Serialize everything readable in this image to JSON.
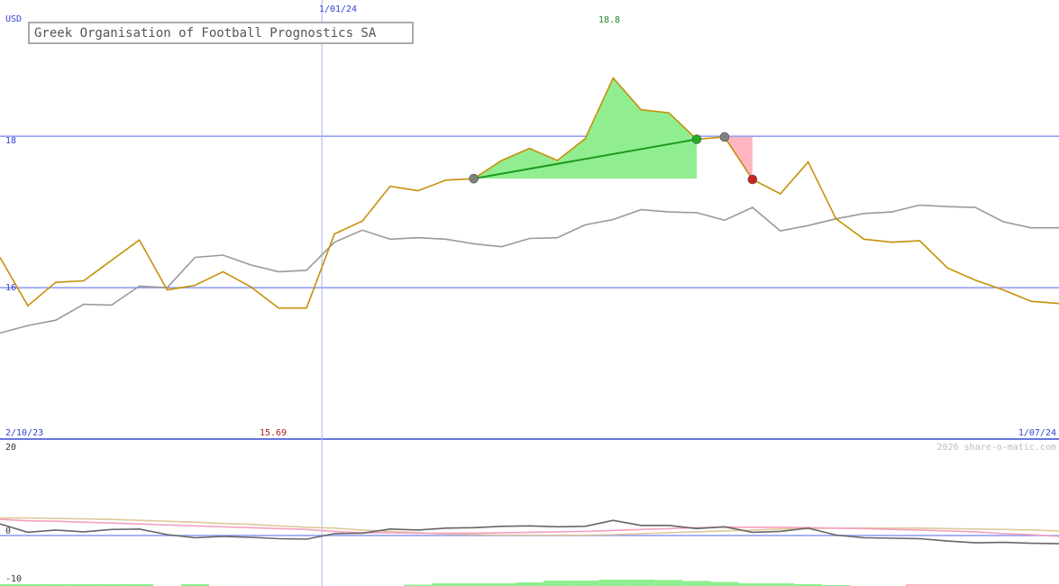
{
  "chart_data": [
    {
      "type": "line",
      "title": "Greek Organisation of Football Prognostics SA",
      "currency": "USD",
      "date_start": "2/10/23",
      "date_marker": "1/01/24",
      "date_end": "1/07/24",
      "y_ticks": [
        "18",
        "16"
      ],
      "ylim": [
        14.0,
        19.8
      ],
      "max_label": "18.8",
      "min_label": "15.69",
      "series": [
        {
          "values": [
            16.4,
            15.76,
            16.07,
            16.09,
            16.36,
            16.63,
            15.97,
            16.03,
            16.21,
            16.01,
            15.73,
            15.73,
            16.71,
            16.88,
            17.34,
            17.28,
            17.42,
            17.44,
            17.68,
            17.84,
            17.68,
            17.97,
            18.77,
            18.35,
            18.31,
            17.96,
            17.99,
            17.43,
            17.24,
            17.66,
            16.91,
            16.64,
            16.6,
            16.62,
            16.26,
            16.1,
            15.97,
            15.82,
            15.79
          ],
          "color": "#c8900a"
        },
        {
          "values": [
            15.4,
            15.5,
            15.57,
            15.78,
            15.77,
            16.02,
            16.0,
            16.4,
            16.43,
            16.3,
            16.21,
            16.23,
            16.6,
            16.76,
            16.64,
            16.66,
            16.64,
            16.58,
            16.54,
            16.65,
            16.66,
            16.83,
            16.9,
            17.03,
            17.0,
            16.99,
            16.89,
            17.06,
            16.75,
            16.82,
            16.91,
            16.98,
            17.0,
            17.09,
            17.07,
            17.06,
            16.87,
            16.79,
            16.79
          ],
          "color": "#999999"
        }
      ],
      "fills": [
        {
          "color": "#90ee90",
          "from": 17,
          "to": 25
        },
        {
          "color": "#ffb6c1",
          "from": 26,
          "to": 27
        }
      ],
      "trend_line": {
        "from": 17,
        "to": 25,
        "color": "#1e9a1e"
      },
      "markers": [
        {
          "index": 17,
          "color": "#808080"
        },
        {
          "index": 25,
          "color": "#22aa22"
        },
        {
          "index": 26,
          "color": "#808080"
        },
        {
          "index": 27,
          "color": "#cc2222"
        }
      ]
    },
    {
      "type": "line",
      "y_ticks": [
        "20",
        "0",
        "-10"
      ],
      "ylim": [
        -11,
        21
      ],
      "watermark": "2026 share-o-matic.com",
      "series": [
        {
          "values": [
            2.5,
            0.7,
            1.2,
            0.8,
            1.3,
            1.4,
            0.2,
            -0.5,
            -0.2,
            -0.4,
            -0.7,
            -0.8,
            0.4,
            0.5,
            1.4,
            1.2,
            1.6,
            1.7,
            2.0,
            2.1,
            1.9,
            2.0,
            3.3,
            2.2,
            2.2,
            1.5,
            1.9,
            0.7,
            0.9,
            1.6,
            0.1,
            -0.5,
            -0.6,
            -0.7,
            -1.2,
            -1.6,
            -1.5,
            -1.7,
            -1.8
          ],
          "color": "#666666"
        },
        {
          "values": [
            3.5,
            3.2,
            3.1,
            2.9,
            2.7,
            2.5,
            2.3,
            2.1,
            1.9,
            1.7,
            1.5,
            1.3,
            0.9,
            0.6,
            0.6,
            0.5,
            0.5,
            0.5,
            0.6,
            0.7,
            0.8,
            0.9,
            1.1,
            1.3,
            1.5,
            1.7,
            1.8,
            1.8,
            1.8,
            1.7,
            1.6,
            1.5,
            1.3,
            1.2,
            1.0,
            0.8,
            0.4,
            0.2,
            -0.2
          ],
          "color": "#f4a0c0"
        },
        {
          "values": [
            3.8,
            3.8,
            3.7,
            3.6,
            3.5,
            3.3,
            3.1,
            2.9,
            2.6,
            2.4,
            2.1,
            1.8,
            1.6,
            1.2,
            0.9,
            0.6,
            0.3,
            0.2,
            0.1,
            0.1,
            0.1,
            0.1,
            0.2,
            0.4,
            0.6,
            0.8,
            1.0,
            1.2,
            1.4,
            1.5,
            1.6,
            1.6,
            1.6,
            1.6,
            1.5,
            1.4,
            1.3,
            1.2,
            1.0
          ],
          "color": "#e0c89a"
        }
      ],
      "histogram": [
        {
          "value": 0.4,
          "color": "#90ee90"
        },
        {
          "value": 0.4,
          "color": "#90ee90"
        },
        {
          "value": 0.4,
          "color": "#90ee90"
        },
        {
          "value": 0.4,
          "color": "#90ee90"
        },
        {
          "value": 0.4,
          "color": "#90ee90"
        },
        {
          "value": 0.4,
          "color": "#90ee90"
        },
        {
          "value": 0.0,
          "color": "#90ee90"
        },
        {
          "value": 0.4,
          "color": "#90ee90"
        },
        {
          "value": 0.0,
          "color": "#90ee90"
        },
        {
          "value": 0.0,
          "color": "#90ee90"
        },
        {
          "value": 0.0,
          "color": "#90ee90"
        },
        {
          "value": 0.0,
          "color": "#90ee90"
        },
        {
          "value": 0.0,
          "color": "#90ee90"
        },
        {
          "value": 0.0,
          "color": "#90ee90"
        },
        {
          "value": 0.0,
          "color": "#90ee90"
        },
        {
          "value": 0.3,
          "color": "#90ee90"
        },
        {
          "value": 0.6,
          "color": "#90ee90"
        },
        {
          "value": 0.6,
          "color": "#90ee90"
        },
        {
          "value": 0.6,
          "color": "#90ee90"
        },
        {
          "value": 0.8,
          "color": "#90ee90"
        },
        {
          "value": 1.2,
          "color": "#90ee90"
        },
        {
          "value": 1.2,
          "color": "#90ee90"
        },
        {
          "value": 1.4,
          "color": "#90ee90"
        },
        {
          "value": 1.4,
          "color": "#90ee90"
        },
        {
          "value": 1.3,
          "color": "#90ee90"
        },
        {
          "value": 1.1,
          "color": "#90ee90"
        },
        {
          "value": 0.9,
          "color": "#90ee90"
        },
        {
          "value": 0.6,
          "color": "#90ee90"
        },
        {
          "value": 0.6,
          "color": "#90ee90"
        },
        {
          "value": 0.4,
          "color": "#90ee90"
        },
        {
          "value": 0.2,
          "color": "#90ee90"
        },
        {
          "value": 0.0,
          "color": "#ffb6c1"
        },
        {
          "value": 0.0,
          "color": "#ffb6c1"
        },
        {
          "value": 0.4,
          "color": "#ffb6c1"
        },
        {
          "value": 0.4,
          "color": "#ffb6c1"
        },
        {
          "value": 0.4,
          "color": "#ffb6c1"
        },
        {
          "value": 0.4,
          "color": "#ffb6c1"
        },
        {
          "value": 0.4,
          "color": "#ffb6c1"
        },
        {
          "value": 0.4,
          "color": "#ffb6c1"
        }
      ]
    }
  ]
}
